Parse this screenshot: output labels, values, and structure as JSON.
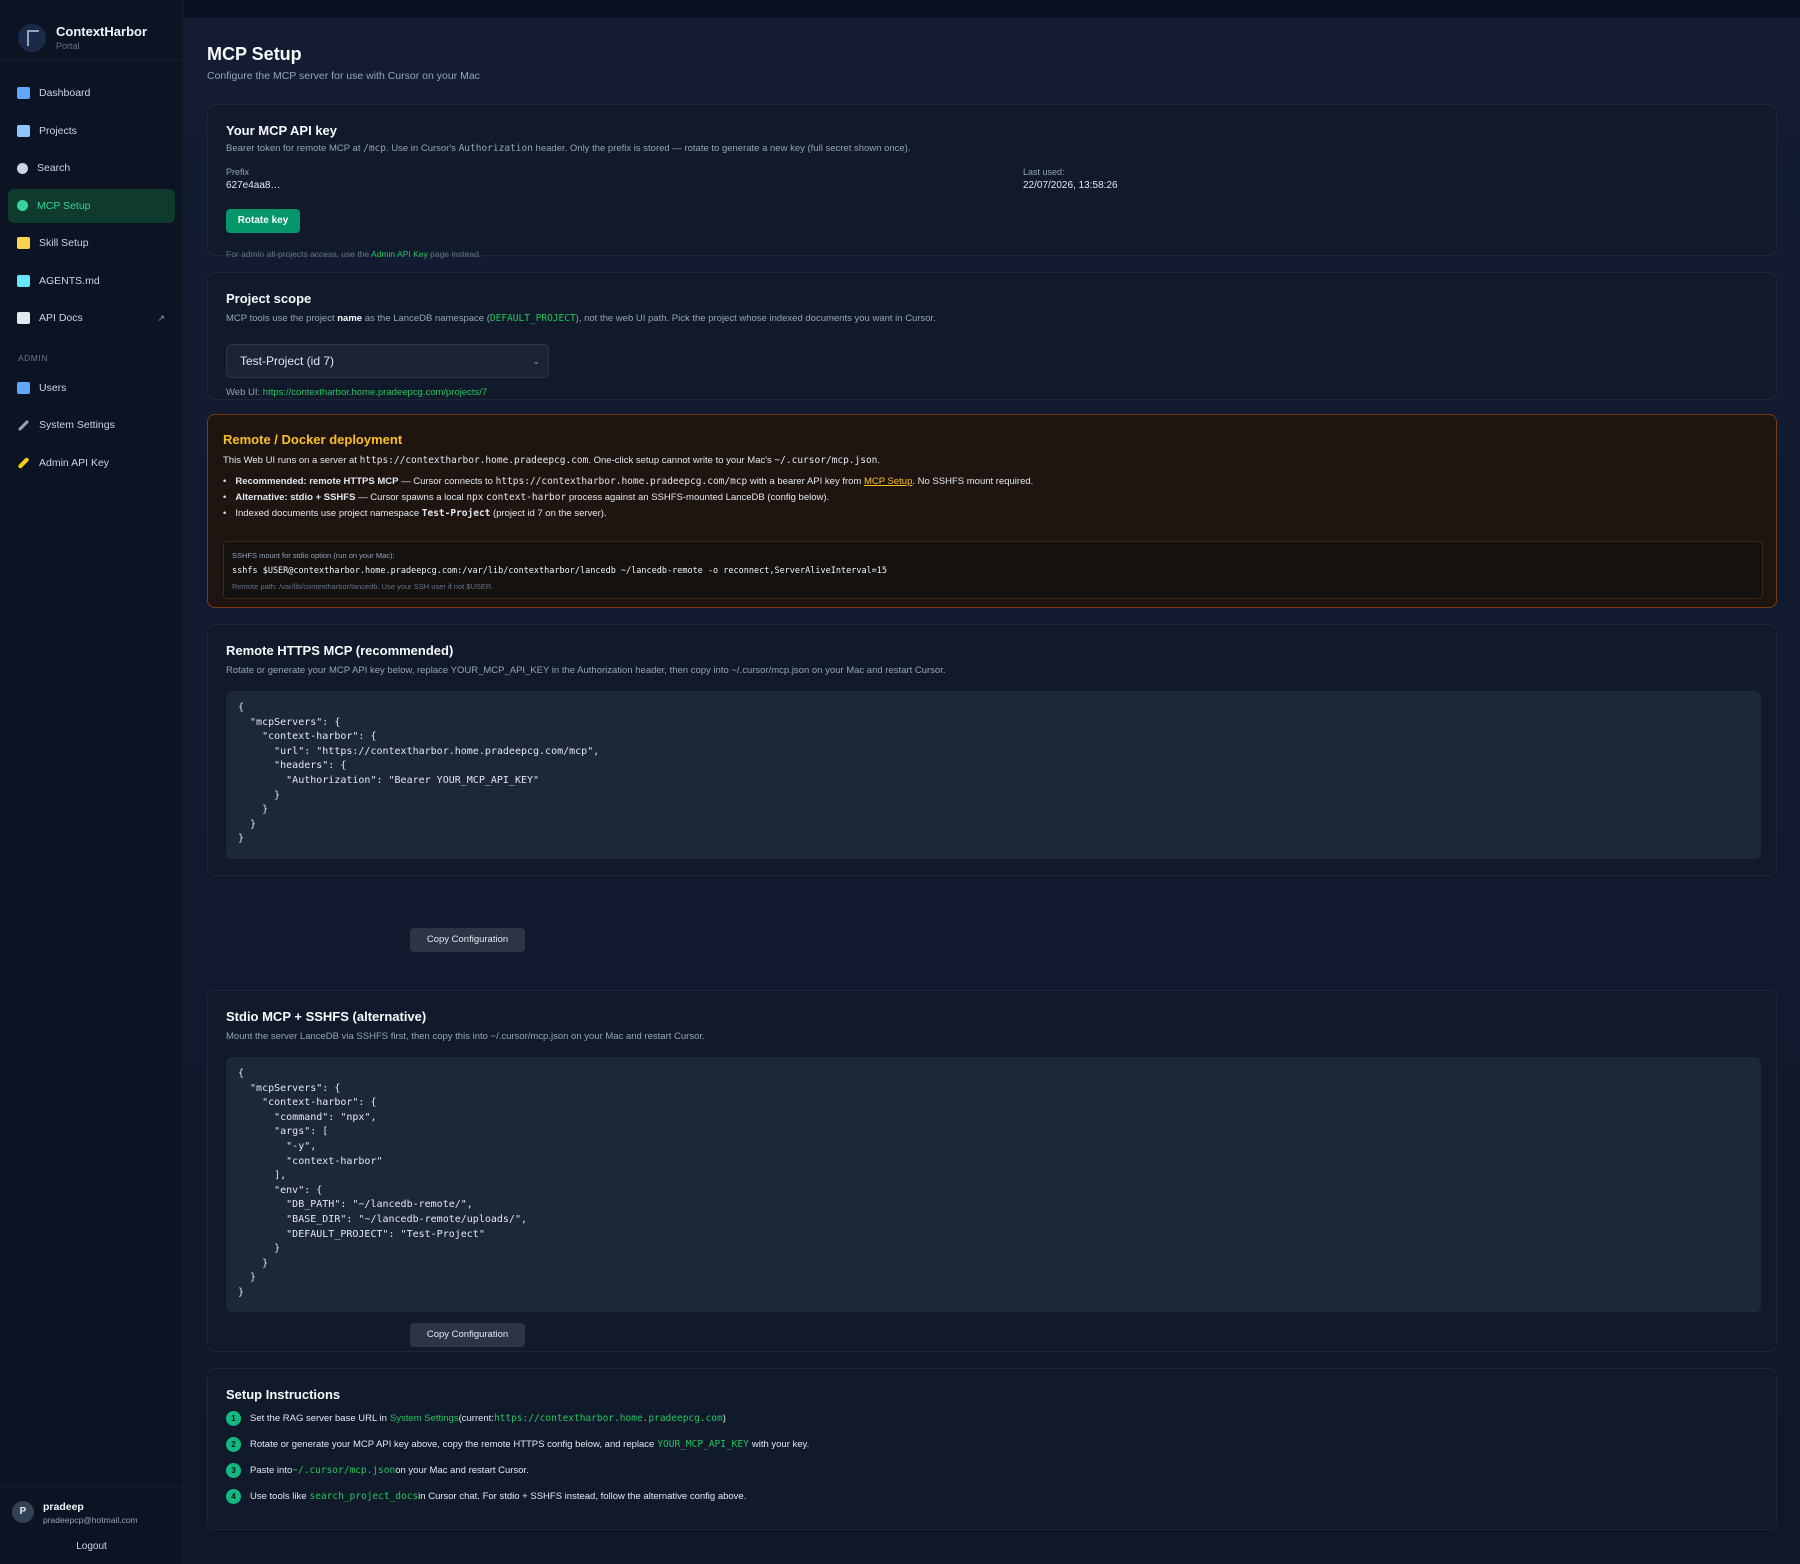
{
  "brand": {
    "name": "ContextHarbor",
    "subtitle": "Portal"
  },
  "nav": {
    "items": [
      {
        "label": "Dashboard",
        "icon": "chart-icon",
        "color": "#60a5fa"
      },
      {
        "label": "Projects",
        "icon": "folder-icon",
        "color": "#93c5fd"
      },
      {
        "label": "Search",
        "icon": "search-icon",
        "color": "#cbd5e1"
      },
      {
        "label": "MCP Setup",
        "icon": "plug-icon",
        "color": "#34d399"
      },
      {
        "label": "Skill Setup",
        "icon": "memo-icon",
        "color": "#fcd34d"
      },
      {
        "label": "AGENTS.md",
        "icon": "robot-icon",
        "color": "#67e8f9"
      },
      {
        "label": "API Docs",
        "icon": "book-icon",
        "color": "#e2e8f0"
      }
    ],
    "admin_section": "ADMIN",
    "admin_items": [
      {
        "label": "Users",
        "icon": "users-icon",
        "color": "#60a5fa"
      },
      {
        "label": "System Settings",
        "icon": "wrench-icon",
        "color": "#94a3b8"
      },
      {
        "label": "Admin API Key",
        "icon": "key-icon",
        "color": "#facc15"
      }
    ],
    "external_indicator": "↗"
  },
  "user": {
    "initial": "P",
    "name": "pradeep",
    "email": "pradeepcp@hotmail.com",
    "logout": "Logout"
  },
  "header": {
    "title": "MCP Setup",
    "subtitle": "Configure the MCP server for use with Cursor on your Mac"
  },
  "api_key": {
    "title": "Your MCP API key",
    "desc_1": "Bearer token for remote MCP at ",
    "desc_path": "/mcp",
    "desc_2": ". Use in Cursor's ",
    "desc_header": "Authorization",
    "desc_3": " header. Only the prefix is stored — rotate to generate a new key (full secret shown once).",
    "prefix_label": "Prefix",
    "prefix_value": "627e4aa8…",
    "last_used_label": "Last used:",
    "last_used_value": "22/07/2026, 13:58:26",
    "rotate_button": "Rotate key",
    "note_1": "For admin all-projects access, use the ",
    "note_link": "Admin API Key",
    "note_2": " page instead."
  },
  "project_scope": {
    "title": "Project scope",
    "desc_1": "MCP tools use the project ",
    "desc_bold": "name",
    "desc_2": " as the LanceDB namespace (",
    "desc_code": "DEFAULT_PROJECT",
    "desc_3": "), not the web UI path. Pick the project whose indexed documents you want in Cursor.",
    "selected": "Test-Project (id 7)",
    "chevron": "⌄",
    "web_ui_label": "Web UI: ",
    "web_ui_url": "https://contextharbor.home.pradeepcg.com/projects/7"
  },
  "remote_docker": {
    "title": "Remote / Docker deployment",
    "p_1": "This Web UI runs on a server at ",
    "p_url": "https://contextharbor.home.pradeepcg.com",
    "p_2": ". One-click setup cannot write to your Mac's ",
    "p_path": "~/.cursor/mcp.json",
    "p_3": ".",
    "b1_bold": "Recommended: remote HTTPS MCP",
    "b1_1": " — Cursor connects to ",
    "b1_url": "https://contextharbor.home.pradeepcg.com/mcp",
    "b1_2": " with a bearer API key from ",
    "b1_link": "MCP Setup",
    "b1_3": ". No SSHFS mount required.",
    "b2_bold": "Alternative: stdio + SSHFS",
    "b2_1": " — Cursor spawns a local ",
    "b2_code1": "npx",
    "b2_space": " ",
    "b2_code2": "context-harbor",
    "b2_2": " process against an SSHFS-mounted LanceDB (config below).",
    "b3_1": "Indexed documents use project namespace ",
    "b3_bold": "Test-Project",
    "b3_2": " (project id 7 on the server).",
    "sshfs_label": "SSHFS mount for stdio option (run on your Mac):",
    "sshfs_cmd": "sshfs $USER@contextharbor.home.pradeepcg.com:/var/lib/contextharbor/lancedb ~/lancedb-remote -o reconnect,ServerAliveInterval=15",
    "sshfs_note": "Remote path: /var/lib/contextharbor/lancedb. Use your SSH user if not $USER."
  },
  "remote_https": {
    "title": "Remote HTTPS MCP (recommended)",
    "desc": "Rotate or generate your MCP API key below, replace YOUR_MCP_API_KEY in the Authorization header, then copy into ~/.cursor/mcp.json on your Mac and restart Cursor.",
    "code": "{\n  \"mcpServers\": {\n    \"context-harbor\": {\n      \"url\": \"https://contextharbor.home.pradeepcg.com/mcp\",\n      \"headers\": {\n        \"Authorization\": \"Bearer YOUR_MCP_API_KEY\"\n      }\n    }\n  }\n}",
    "copy_button": "Copy Configuration"
  },
  "stdio": {
    "title": "Stdio MCP + SSHFS (alternative)",
    "desc": "Mount the server LanceDB via SSHFS first, then copy this into ~/.cursor/mcp.json on your Mac and restart Cursor.",
    "code": "{\n  \"mcpServers\": {\n    \"context-harbor\": {\n      \"command\": \"npx\",\n      \"args\": [\n        \"-y\",\n        \"context-harbor\"\n      ],\n      \"env\": {\n        \"DB_PATH\": \"~/lancedb-remote/\",\n        \"BASE_DIR\": \"~/lancedb-remote/uploads/\",\n        \"DEFAULT_PROJECT\": \"Test-Project\"\n      }\n    }\n  }\n}",
    "copy_button": "Copy Configuration"
  },
  "instructions": {
    "title": "Setup Instructions",
    "steps": [
      {
        "num": "1",
        "t1": "Set the RAG server base URL in ",
        "link": "System Settings",
        "t2": " (current: ",
        "code": "https://contextharbor.home.pradeepcg.com",
        "t3": ")"
      },
      {
        "num": "2",
        "t1": "Rotate or generate your MCP API key above, copy the remote HTTPS config below, and replace ",
        "code": "YOUR_MCP_API_KEY",
        "t2": " with your key."
      },
      {
        "num": "3",
        "t1": "Paste into ",
        "code": "~/.cursor/mcp.json",
        "t2": " on your Mac and restart Cursor."
      },
      {
        "num": "4",
        "t1": "Use tools like ",
        "code": "search_project_docs",
        "t2": " in Cursor chat. For stdio + SSHFS instead, follow the alternative config above."
      }
    ]
  },
  "colors": {
    "accent": "#10b981",
    "warning_title": "#fbbf24",
    "background": "#0b1120"
  }
}
